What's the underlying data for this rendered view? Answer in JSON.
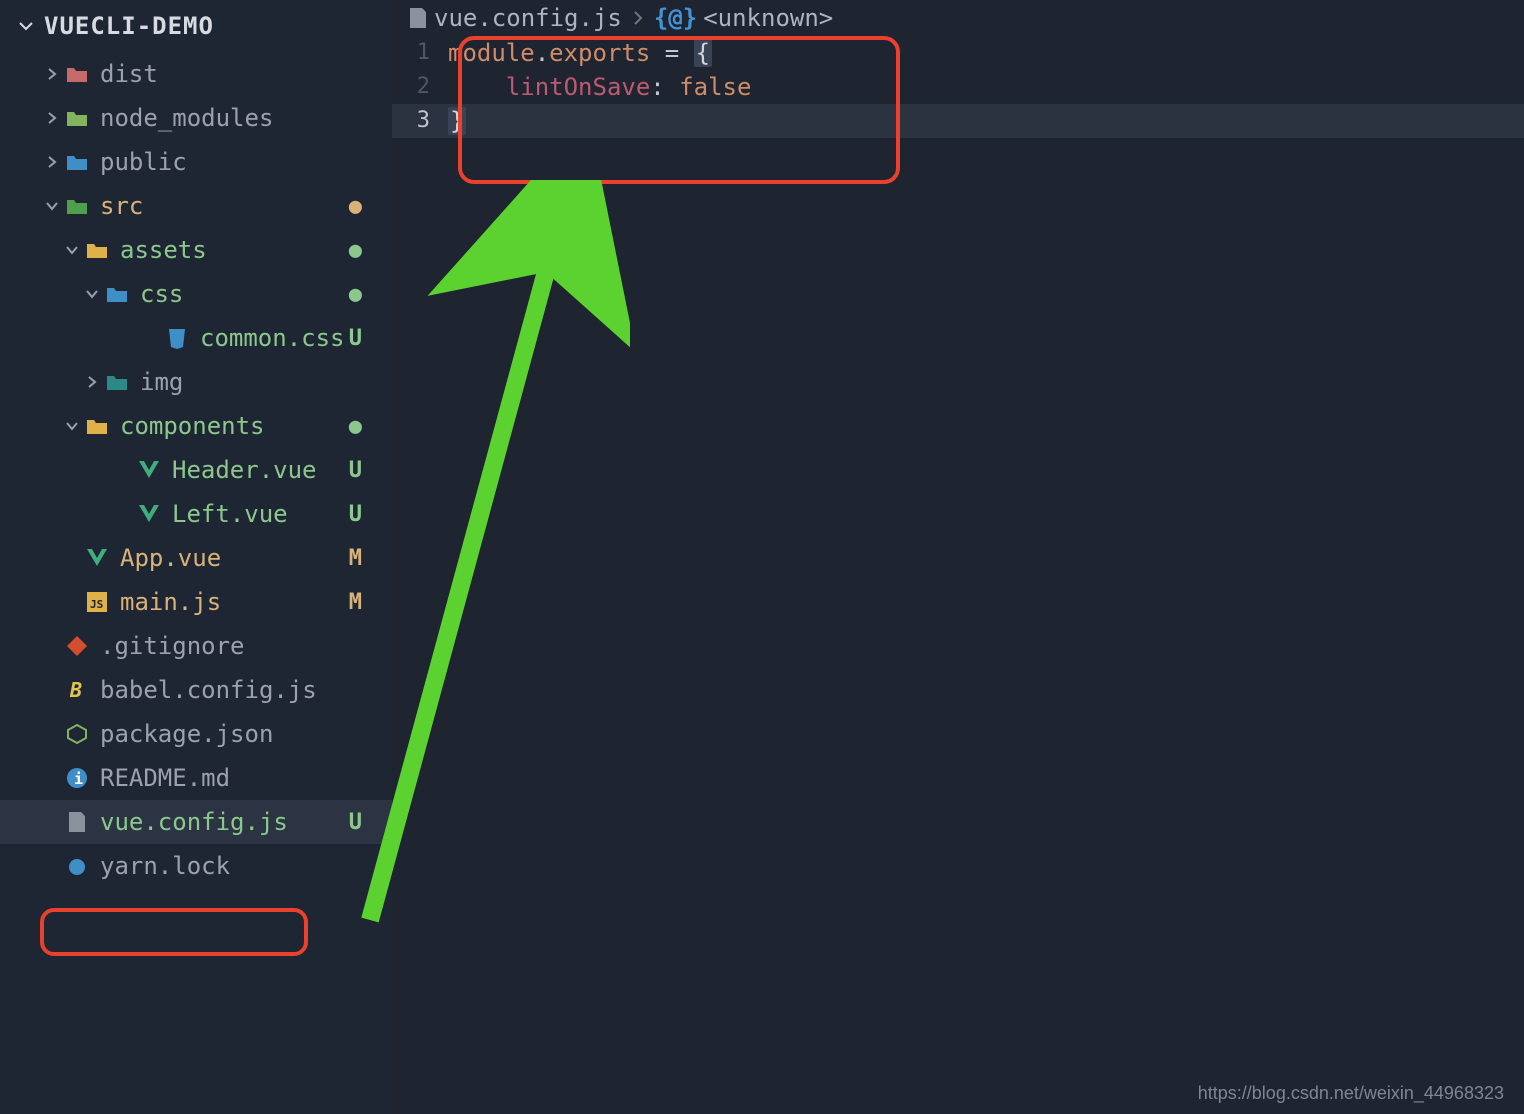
{
  "project": {
    "name": "VUECLI-DEMO"
  },
  "tree": {
    "dist": "dist",
    "node_modules": "node_modules",
    "public": "public",
    "src": "src",
    "assets": "assets",
    "css": "css",
    "common_css": "common.css",
    "img": "img",
    "components": "components",
    "header_vue": "Header.vue",
    "left_vue": "Left.vue",
    "app_vue": "App.vue",
    "main_js": "main.js",
    "gitignore": ".gitignore",
    "babel_config": "babel.config.js",
    "package_json": "package.json",
    "readme": "README.md",
    "vue_config": "vue.config.js",
    "yarn_lock": "yarn.lock"
  },
  "git": {
    "u": "U",
    "m": "M",
    "dot": "●"
  },
  "breadcrumb": {
    "file": "vue.config.js",
    "symbol_icon": "{@}",
    "unknown": "<unknown>"
  },
  "code": {
    "line1": {
      "num": "1",
      "module": "module",
      "dot": ".",
      "exports": "exports",
      "eq": " = ",
      "brace": "{"
    },
    "line2": {
      "num": "2",
      "indent": "    ",
      "key": "lintOnSave",
      "colon": ": ",
      "value": "false"
    },
    "line3": {
      "num": "3",
      "brace": "}"
    }
  },
  "watermark": "https://blog.csdn.net/weixin_44968323"
}
